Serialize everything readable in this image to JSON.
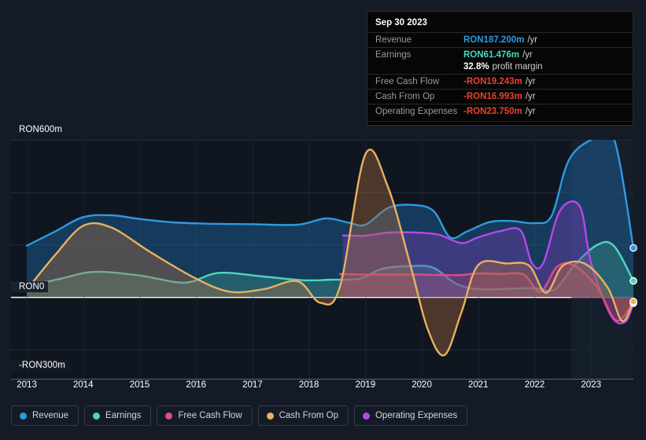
{
  "tooltip": {
    "date": "Sep 30 2023",
    "rows": [
      {
        "label": "Revenue",
        "value": "RON187.200m",
        "unit": "/yr",
        "color": "#2e9ae0"
      },
      {
        "label": "Earnings",
        "value": "RON61.476m",
        "unit": "/yr",
        "color": "#4bd6bc"
      },
      {
        "label": "",
        "value": "32.8%",
        "unit": "profit margin",
        "color": "#ffffff"
      },
      {
        "label": "Free Cash Flow",
        "value": "-RON19.243m",
        "unit": "/yr",
        "color": "#e8422e"
      },
      {
        "label": "Cash From Op",
        "value": "-RON16.993m",
        "unit": "/yr",
        "color": "#e8422e"
      },
      {
        "label": "Operating Expenses",
        "value": "-RON23.750m",
        "unit": "/yr",
        "color": "#e8422e"
      }
    ]
  },
  "legend": {
    "items": [
      {
        "label": "Revenue",
        "color": "#2e9ae0"
      },
      {
        "label": "Earnings",
        "color": "#4bd6bc"
      },
      {
        "label": "Free Cash Flow",
        "color": "#d94f7f"
      },
      {
        "label": "Cash From Op",
        "color": "#e8b25e"
      },
      {
        "label": "Operating Expenses",
        "color": "#b44ae8"
      }
    ]
  },
  "chart_data": {
    "type": "area",
    "title": "",
    "xlabel": "",
    "ylabel": "",
    "grid": true,
    "legend_position": "bottom",
    "ylim": [
      -300,
      600
    ],
    "y_ticks": [
      600,
      0,
      -300
    ],
    "y_tick_labels": [
      "RON600m",
      "RON0",
      "-RON300m"
    ],
    "y_gridlines": [
      600,
      400,
      200,
      0,
      -200
    ],
    "x": [
      2013,
      2014,
      2015,
      2016,
      2017,
      2018,
      2019,
      2020,
      2021,
      2022,
      2023
    ],
    "x_tick_labels": [
      "2013",
      "2014",
      "2015",
      "2016",
      "2017",
      "2018",
      "2019",
      "2020",
      "2021",
      "2022",
      "2023"
    ],
    "currency": "RON",
    "units": "millions",
    "series": [
      {
        "name": "Revenue",
        "color": "#2e9ae0",
        "fill": "rgba(30,110,175,0.42)",
        "x": [
          2013.0,
          2013.5,
          2014.0,
          2014.5,
          2015.0,
          2015.6,
          2016.2,
          2017.0,
          2017.8,
          2018.3,
          2018.7,
          2019.0,
          2019.4,
          2019.8,
          2020.2,
          2020.5,
          2020.8,
          2021.2,
          2021.6,
          2022.0,
          2022.3,
          2022.6,
          2023.0,
          2023.4,
          2023.75
        ],
        "values": [
          196,
          250,
          305,
          312,
          298,
          285,
          280,
          278,
          276,
          300,
          284,
          276,
          340,
          352,
          330,
          228,
          250,
          286,
          290,
          282,
          310,
          520,
          600,
          607,
          187.2
        ],
        "end_value": 187.2
      },
      {
        "name": "Earnings",
        "color": "#4bd6bc",
        "fill": "rgba(58,150,140,0.40)",
        "x": [
          2013.0,
          2013.6,
          2014.2,
          2015.0,
          2015.8,
          2016.4,
          2017.2,
          2017.9,
          2018.4,
          2018.9,
          2019.3,
          2019.8,
          2020.2,
          2020.6,
          2021.0,
          2021.6,
          2022.0,
          2022.35,
          2022.7,
          2023.1,
          2023.4,
          2023.75
        ],
        "values": [
          40,
          70,
          96,
          82,
          55,
          92,
          78,
          64,
          66,
          70,
          108,
          118,
          112,
          52,
          30,
          32,
          34,
          28,
          120,
          198,
          196,
          61.476
        ],
        "end_value": 61.476
      },
      {
        "name": "Free Cash Flow",
        "color": "#d94f7f",
        "fill": "rgba(170,70,110,0.35)",
        "x": [
          2018.55,
          2018.9,
          2019.4,
          2019.9,
          2020.3,
          2020.7,
          2021.0,
          2021.4,
          2021.8,
          2022.1,
          2022.4,
          2022.7,
          2023.1,
          2023.45,
          2023.75
        ],
        "values": [
          88,
          86,
          86,
          86,
          84,
          84,
          90,
          88,
          86,
          20,
          116,
          120,
          40,
          -90,
          -19.243
        ],
        "end_value": -19.243
      },
      {
        "name": "Cash From Op",
        "color": "#e8b25e",
        "fill": "rgba(180,110,65,0.38)",
        "x": [
          2013.0,
          2013.5,
          2014.0,
          2014.5,
          2015.2,
          2016.0,
          2016.6,
          2017.2,
          2017.8,
          2018.2,
          2018.55,
          2019.0,
          2019.4,
          2019.8,
          2020.1,
          2020.4,
          2020.7,
          2021.0,
          2021.5,
          2021.9,
          2022.2,
          2022.5,
          2022.9,
          2023.3,
          2023.55,
          2023.75
        ],
        "values": [
          28,
          160,
          272,
          265,
          170,
          70,
          20,
          30,
          60,
          -22,
          40,
          545,
          420,
          120,
          -120,
          -222,
          -60,
          122,
          128,
          120,
          16,
          120,
          126,
          34,
          -92,
          -16.993
        ],
        "end_value": -16.993
      },
      {
        "name": "Operating Expenses",
        "color": "#b44ae8",
        "fill": "rgba(120,60,180,0.42)",
        "x": [
          2018.6,
          2019.0,
          2019.4,
          2019.9,
          2020.3,
          2020.7,
          2021.0,
          2021.4,
          2021.75,
          2021.95,
          2022.15,
          2022.45,
          2022.8,
          2023.0,
          2023.35,
          2023.6,
          2023.75
        ],
        "values": [
          235,
          234,
          246,
          246,
          238,
          206,
          228,
          252,
          254,
          130,
          128,
          330,
          346,
          130,
          -70,
          -96,
          -23.75
        ],
        "end_value": -23.75
      }
    ]
  },
  "axis": {
    "zero_line_color": "#ffffff",
    "gridline_color": "#2b3440",
    "background": "#151b26",
    "plot_background": "#111722"
  }
}
